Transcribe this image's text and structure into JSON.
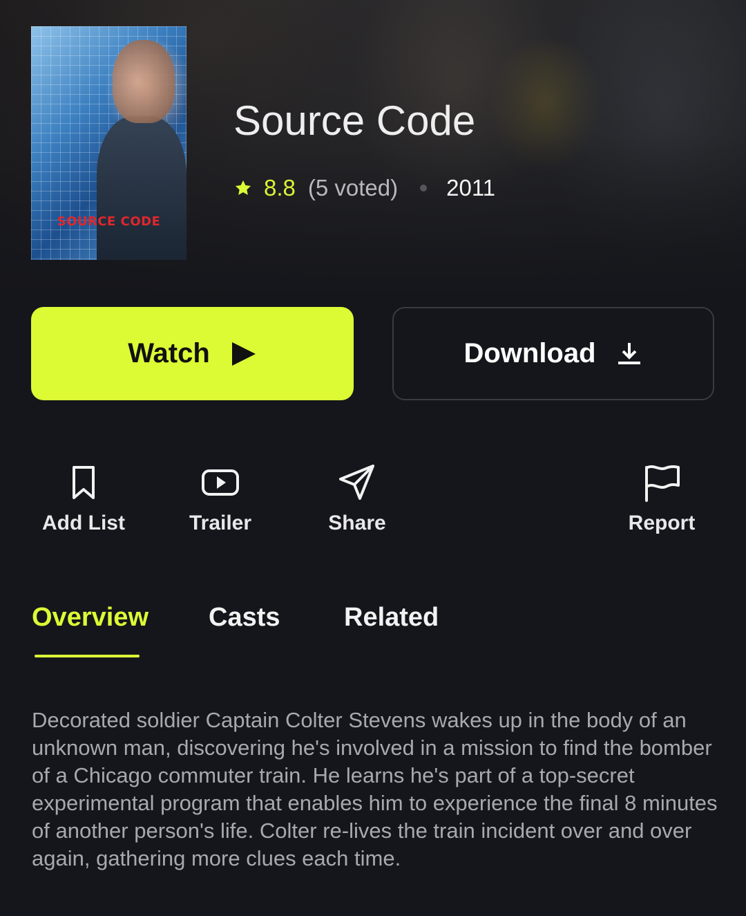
{
  "movie": {
    "poster_text": "SOURCE CODE",
    "title": "Source Code",
    "rating": "8.8",
    "votes": "(5 voted)",
    "year": "2011"
  },
  "buttons": {
    "watch_label": "Watch",
    "download_label": "Download"
  },
  "actions": [
    {
      "label": "Add List",
      "icon": "bookmark-icon"
    },
    {
      "label": "Trailer",
      "icon": "play-video-icon"
    },
    {
      "label": "Share",
      "icon": "send-icon"
    },
    {
      "label": "Report",
      "icon": "flag-icon"
    }
  ],
  "tabs": [
    {
      "label": "Overview",
      "active": true
    },
    {
      "label": "Casts",
      "active": false
    },
    {
      "label": "Related",
      "active": false
    }
  ],
  "overview": "Decorated soldier Captain Colter Stevens wakes up in the body of an unknown man, discovering he's involved in a mission to find the bomber of a Chicago commuter train. He learns he's part of a top-secret experimental program that enables him to experience the final 8 minutes of another person's life. Colter re-lives the train incident over and over again, gathering more clues each time.",
  "colors": {
    "accent": "#dcfb35",
    "background": "#15161b",
    "muted_text": "#a8a9ae"
  }
}
